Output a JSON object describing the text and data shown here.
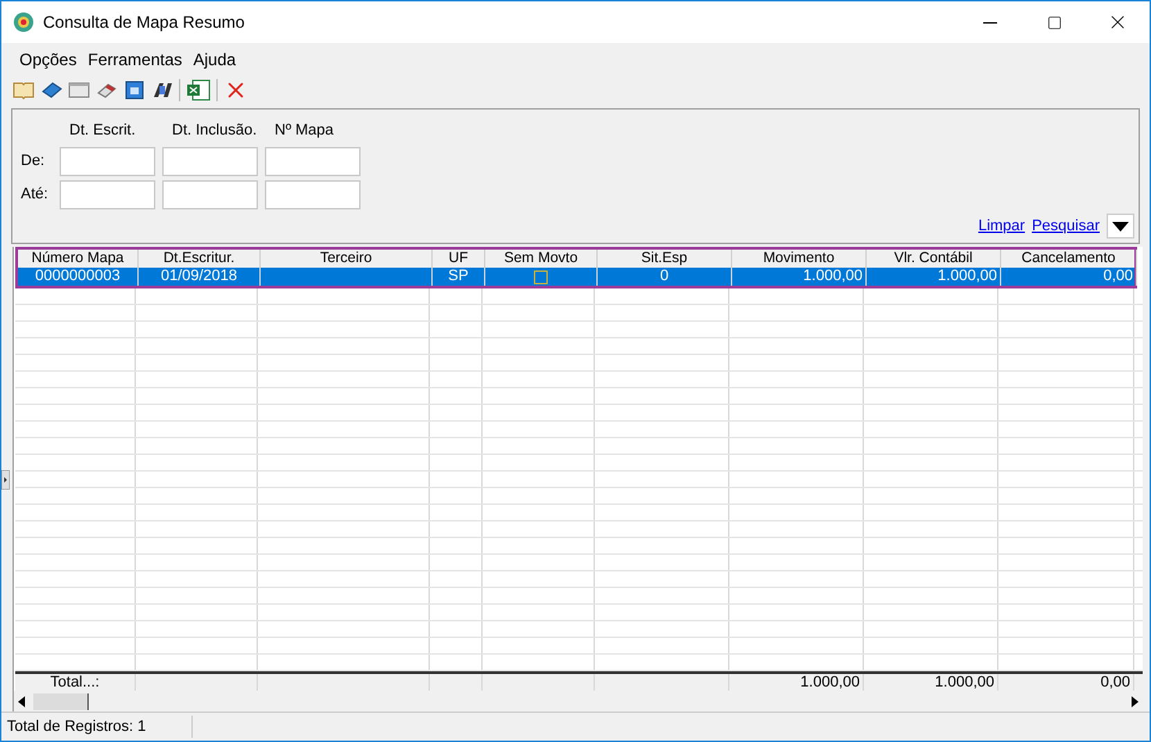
{
  "window": {
    "title": "Consulta de Mapa Resumo"
  },
  "menu": [
    "Opções",
    "Ferramentas",
    "Ajuda"
  ],
  "filters": {
    "columns": [
      "Dt. Escrit.",
      "Dt. Inclusão.",
      "Nº Mapa"
    ],
    "rows": [
      "De:",
      "Até:"
    ],
    "links": [
      "Limpar",
      "Pesquisar"
    ]
  },
  "table": {
    "columns": [
      "Número Mapa",
      "Dt.Escritur.",
      "Terceiro",
      "UF",
      "Sem Movto",
      "Sit.Esp",
      "Movimento",
      "Vlr. Contábil",
      "Cancelamento"
    ],
    "rows": [
      {
        "selected": true,
        "cells": [
          "0000000003",
          "01/09/2018",
          "",
          "SP",
          "",
          "0",
          "1.000,00",
          "1.000,00",
          "0,00"
        ],
        "sem_movto_checked": false
      }
    ],
    "totals": {
      "label": "Total...:",
      "values": [
        "1.000,00",
        "1.000,00",
        "0,00"
      ]
    }
  },
  "status_bar": "Total de Registros: 1"
}
